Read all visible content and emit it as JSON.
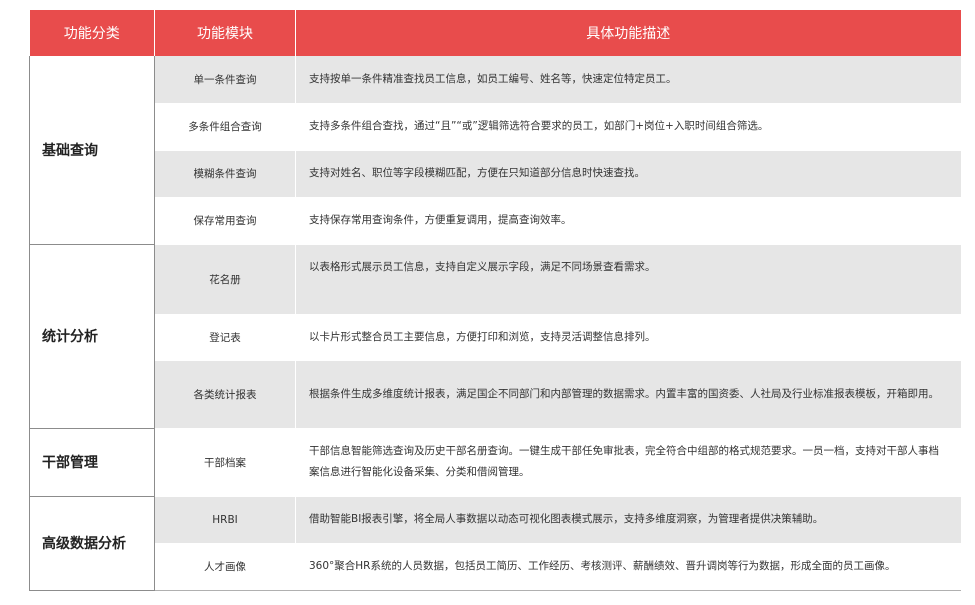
{
  "header": {
    "col1": "功能分类",
    "col2": "功能模块",
    "col3": "具体功能描述"
  },
  "groups": [
    {
      "category": "基础查询",
      "rows": [
        {
          "module": "单一条件查询",
          "description": "支持按单一条件精准查找员工信息，如员工编号、姓名等，快速定位特定员工。"
        },
        {
          "module": "多条件组合查询",
          "description": "支持多条件组合查找，通过“且”“或”逻辑筛选符合要求的员工，如部门+岗位+入职时间组合筛选。"
        },
        {
          "module": "模糊条件查询",
          "description": "支持对姓名、职位等字段模糊匹配，方便在只知道部分信息时快速查找。"
        },
        {
          "module": "保存常用查询",
          "description": "支持保存常用查询条件，方便重复调用，提高查询效率。"
        }
      ]
    },
    {
      "category": "统计分析",
      "rows": [
        {
          "module": "花名册",
          "description": "以表格形式展示员工信息，支持自定义展示字段，满足不同场景查看需求。"
        },
        {
          "module": "登记表",
          "description": "以卡片形式整合员工主要信息，方便打印和浏览，支持灵活调整信息排列。"
        },
        {
          "module": "各类统计报表",
          "description": "根据条件生成多维度统计报表，满足国企不同部门和内部管理的数据需求。内置丰富的国资委、人社局及行业标准报表模板，开箱即用。"
        }
      ]
    },
    {
      "category": "干部管理",
      "rows": [
        {
          "module": "干部档案",
          "description": "干部信息智能筛选查询及历史干部名册查询。一键生成干部任免审批表，完全符合中组部的格式规范要求。一员一档，支持对干部人事档案信息进行智能化设备采集、分类和借阅管理。"
        }
      ]
    },
    {
      "category": "高级数据分析",
      "rows": [
        {
          "module": "HRBI",
          "description": "借助智能BI报表引擎，将全局人事数据以动态可视化图表模式展示，支持多维度洞察，为管理者提供决策辅助。"
        },
        {
          "module": "人才画像",
          "description": "360°聚合HR系统的人员数据，包括员工简历、工作经历、考核测评、薪酬绩效、晋升调岗等行为数据，形成全面的员工画像。"
        }
      ]
    }
  ]
}
